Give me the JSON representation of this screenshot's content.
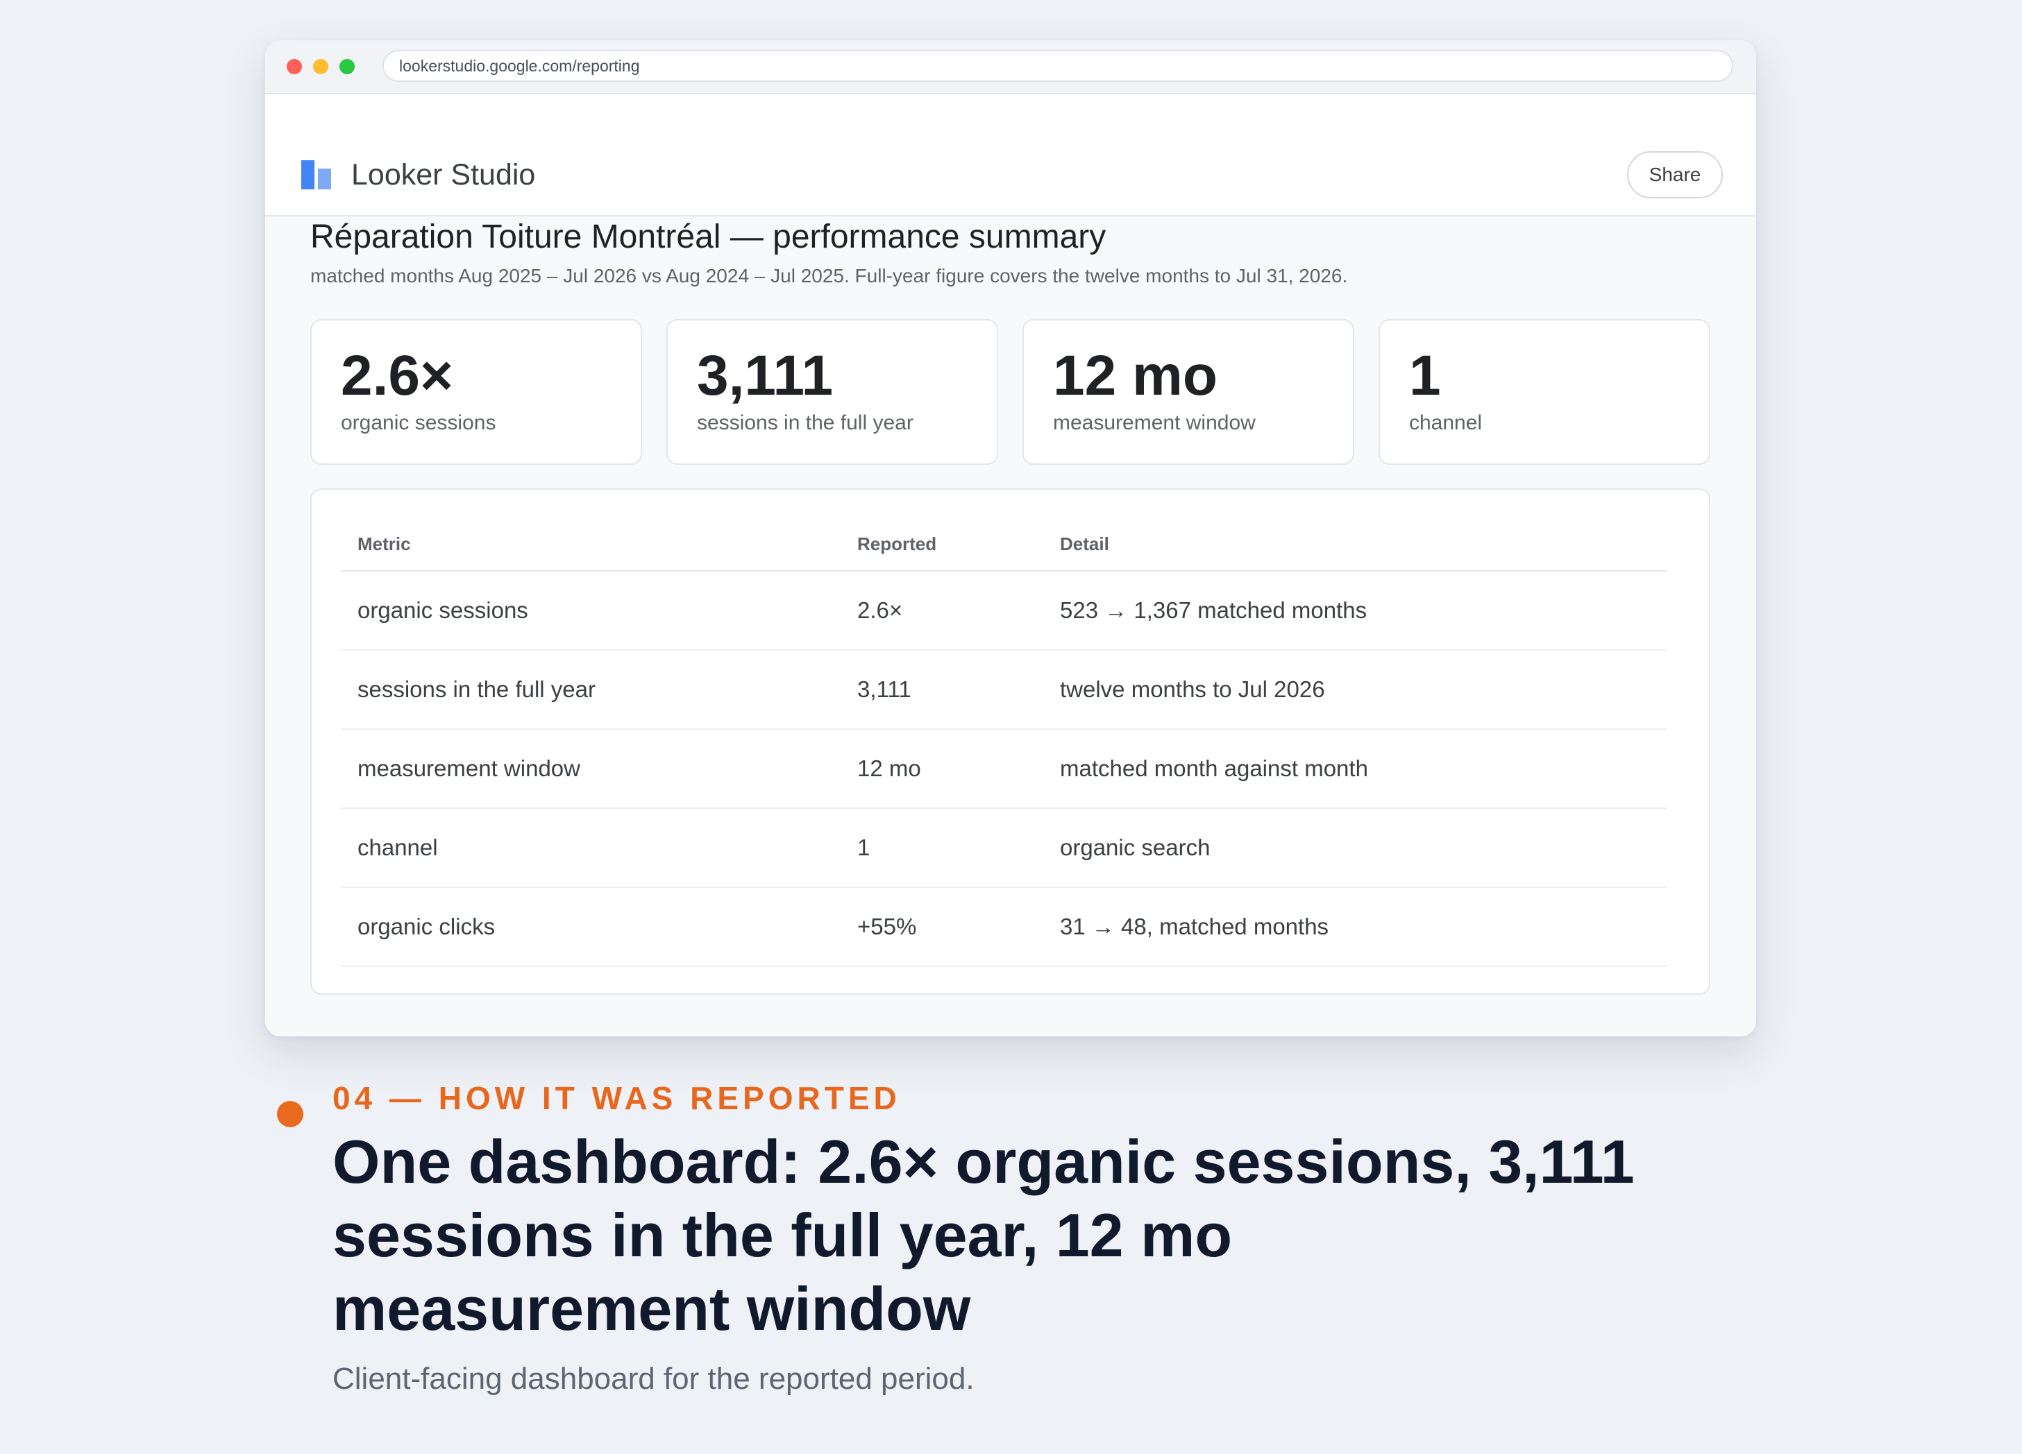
{
  "browser": {
    "url": "lookerstudio.google.com/reporting"
  },
  "app": {
    "name": "Looker Studio",
    "share_label": "Share",
    "logo_icon": "looker-studio-logo-icon",
    "accent_color": "#4285f4"
  },
  "report": {
    "title": "Réparation Toiture Montréal — performance summary",
    "subtitle": "matched months Aug 2025 – Jul 2026 vs Aug 2024 – Jul 2025. Full-year figure covers the twelve months to Jul 31, 2026."
  },
  "kpis": [
    {
      "value": "2.6×",
      "label": "organic sessions"
    },
    {
      "value": "3,111",
      "label": "sessions in the full year"
    },
    {
      "value": "12 mo",
      "label": "measurement window"
    },
    {
      "value": "1",
      "label": "channel"
    }
  ],
  "table": {
    "headers": [
      "Metric",
      "Reported",
      "Detail"
    ],
    "rows": [
      {
        "metric": "organic sessions",
        "reported": "2.6×",
        "detail": "523 → 1,367 matched months"
      },
      {
        "metric": "sessions in the full year",
        "reported": "3,111",
        "detail": "twelve months to Jul 2026"
      },
      {
        "metric": "measurement window",
        "reported": "12 mo",
        "detail": "matched month against month"
      },
      {
        "metric": "channel",
        "reported": "1",
        "detail": "organic search"
      },
      {
        "metric": "organic clicks",
        "reported": "+55%",
        "detail": "31 → 48, matched months"
      }
    ]
  },
  "section": {
    "eyebrow": "04 — HOW IT WAS REPORTED",
    "headline": "One dashboard: 2.6× organic sessions, 3,111 sessions in the full year, 12 mo measurement window",
    "caption": "Client-facing dashboard for the reported period.",
    "accent_color": "#e8671e"
  }
}
